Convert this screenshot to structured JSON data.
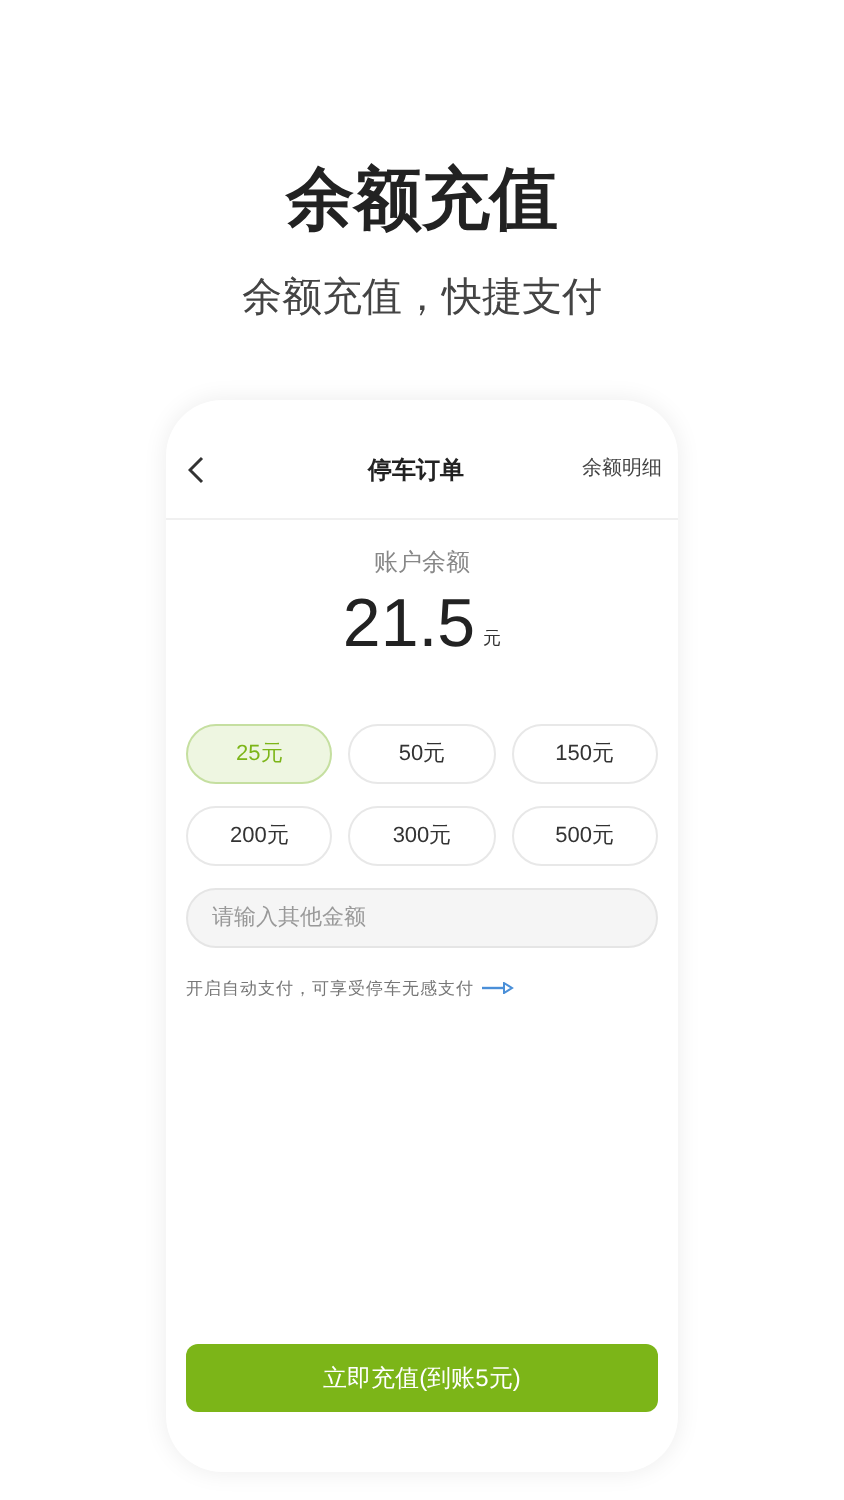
{
  "headline": "余额充值",
  "subtitle": "余额充值，快捷支付",
  "nav": {
    "title": "停车订单",
    "action": "余额明细"
  },
  "balance": {
    "label": "账户余额",
    "amount": "21.5",
    "unit": "元"
  },
  "options": [
    {
      "label": "25元",
      "selected": true
    },
    {
      "label": "50元",
      "selected": false
    },
    {
      "label": "150元",
      "selected": false
    },
    {
      "label": "200元",
      "selected": false
    },
    {
      "label": "300元",
      "selected": false
    },
    {
      "label": "500元",
      "selected": false
    }
  ],
  "custom_amount": {
    "placeholder": "请输入其他金额"
  },
  "auto_pay_note": "开启自动支付，可享受停车无感支付",
  "submit": "立即充值(到账5元)"
}
